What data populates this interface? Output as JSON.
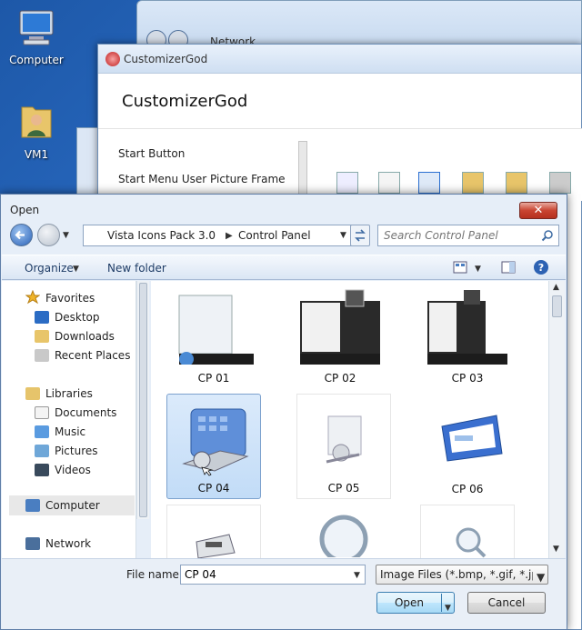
{
  "desktop": {
    "icons": [
      {
        "label": "Computer",
        "icon": "computer-icon"
      },
      {
        "label": "VM1",
        "icon": "user-folder-icon"
      }
    ]
  },
  "explorer_bg": {
    "breadcrumb": "Network"
  },
  "customizer": {
    "title": "CustomizerGod",
    "heading": "CustomizerGod",
    "list_items": [
      "Start Button",
      "Start Menu User Picture Frame"
    ]
  },
  "open_dialog": {
    "title": "Open",
    "close_label": "✕",
    "address": {
      "segments": [
        "Vista Icons Pack 3.0",
        "Control Panel"
      ]
    },
    "search_placeholder": "Search Control Panel",
    "toolbar": {
      "organize": "Organize",
      "new_folder": "New folder"
    },
    "sidebar": {
      "favorites": "Favorites",
      "favorites_items": [
        "Desktop",
        "Downloads",
        "Recent Places"
      ],
      "libraries": "Libraries",
      "libraries_items": [
        "Documents",
        "Music",
        "Pictures",
        "Videos"
      ],
      "computer": "Computer",
      "network": "Network"
    },
    "files": [
      {
        "name": "CP 01",
        "selected": false
      },
      {
        "name": "CP 02",
        "selected": false
      },
      {
        "name": "CP 03",
        "selected": false
      },
      {
        "name": "CP 04",
        "selected": true
      },
      {
        "name": "CP 05",
        "selected": false
      },
      {
        "name": "CP 06",
        "selected": false
      }
    ],
    "file_name_label": "File name:",
    "file_name_value": "CP 04",
    "filter": "Image Files (*.bmp, *.gif, *.jpg,",
    "open_button": "Open",
    "cancel_button": "Cancel"
  },
  "colors": {
    "title_accent": "#c94431",
    "selection": "#c2dcf7",
    "desktop": "#2b6cc4"
  }
}
